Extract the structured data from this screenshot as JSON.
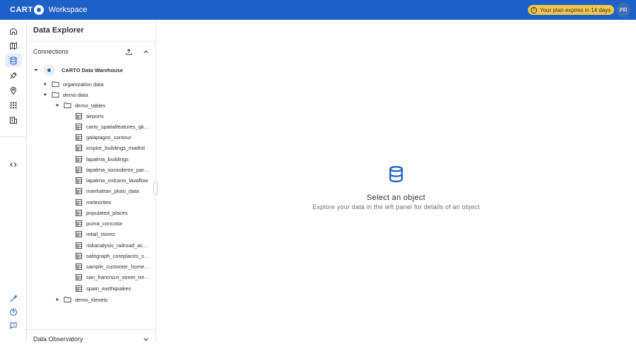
{
  "topbar": {
    "brand": "CART",
    "brand_end": "",
    "product": "Workspace",
    "plan_notice": "Your plan expires in 14 days",
    "user_initials": "PR",
    "accent": "#1d60c7",
    "badge_color": "#f5c54a"
  },
  "rail": {
    "items": [
      {
        "icon": "home-icon"
      },
      {
        "icon": "map-icon"
      },
      {
        "icon": "database-icon",
        "active": true
      },
      {
        "icon": "workflow-icon"
      },
      {
        "icon": "location-pin-icon"
      },
      {
        "icon": "apps-grid-icon"
      },
      {
        "icon": "building-icon"
      },
      {
        "icon": "code-icon"
      },
      {
        "icon": "magic-icon"
      },
      {
        "icon": "help-icon"
      },
      {
        "icon": "feedback-icon"
      }
    ]
  },
  "panel": {
    "title": "Data Explorer",
    "connections_label": "Connections",
    "observatory_label": "Data Observatory",
    "warehouse": "CARTO Data Warehouse",
    "folders": {
      "organization": "organization data",
      "demo": "demo data",
      "demo_tables": "demo_tables",
      "demo_tilesets": "demo_tilesets"
    },
    "tables": [
      "airports",
      "carto_spatialfeatures_qk_usa",
      "galapagos_contour",
      "inspire_buildings_madrid",
      "lapalma_buildings",
      "lapalma_sociodemo_parcels",
      "lapalma_volcano_lavaflow",
      "manhattan_pluto_data",
      "meteorites",
      "populated_places",
      "puma_concolor",
      "retail_stores",
      "riskanalysis_railroad_accidents",
      "safegraph_coreplaces_stores",
      "sample_customer_home_locations",
      "san_francisco_street_trees",
      "spain_earthquakes"
    ]
  },
  "main": {
    "empty_title": "Select an object",
    "empty_subtitle": "Explore your data in the left panel for details of an object"
  }
}
